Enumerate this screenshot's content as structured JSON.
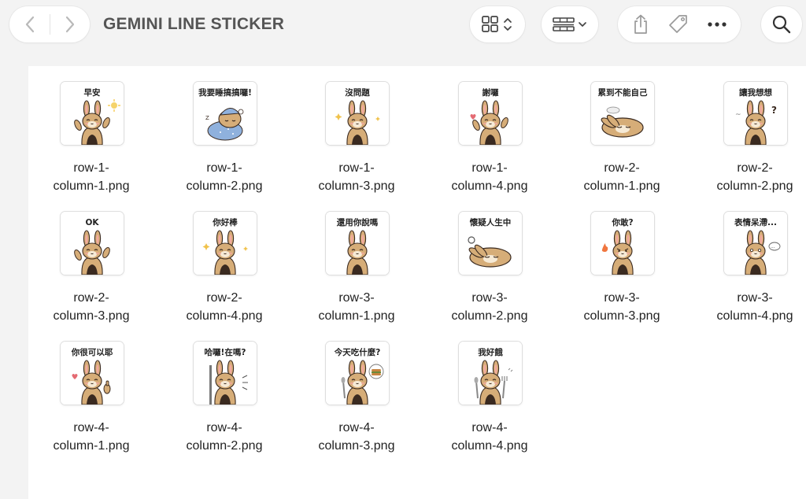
{
  "toolbar": {
    "title": "GEMINI LINE STICKER"
  },
  "files": [
    {
      "line1": "row-1-",
      "line2": "column-1.png",
      "caption": "早安",
      "pose": "wave",
      "prop": "sun"
    },
    {
      "line1": "row-1-",
      "line2": "column-2.png",
      "caption": "我要睡搞搞囉!",
      "pose": "sleep",
      "prop": "pillow"
    },
    {
      "line1": "row-1-",
      "line2": "column-3.png",
      "caption": "沒問題",
      "pose": "ok",
      "prop": "sparkle"
    },
    {
      "line1": "row-1-",
      "line2": "column-4.png",
      "caption": "謝囉",
      "pose": "thanks",
      "prop": "heart"
    },
    {
      "line1": "row-2-",
      "line2": "column-1.png",
      "caption": "累到不能自己",
      "pose": "lying",
      "prop": "cloud"
    },
    {
      "line1": "row-2-",
      "line2": "column-2.png",
      "caption": "讓我想想",
      "pose": "think",
      "prop": "question"
    },
    {
      "line1": "row-2-",
      "line2": "column-3.png",
      "caption": "OK",
      "pose": "wave",
      "prop": "none"
    },
    {
      "line1": "row-2-",
      "line2": "column-4.png",
      "caption": "你好棒",
      "pose": "clap",
      "prop": "sparkle"
    },
    {
      "line1": "row-3-",
      "line2": "column-1.png",
      "caption": "還用你說嗎",
      "pose": "arms",
      "prop": "none"
    },
    {
      "line1": "row-3-",
      "line2": "column-2.png",
      "caption": "懷疑人生中",
      "pose": "lying",
      "prop": "swirl"
    },
    {
      "line1": "row-3-",
      "line2": "column-3.png",
      "caption": "你敢?",
      "pose": "angry",
      "prop": "fire"
    },
    {
      "line1": "row-3-",
      "line2": "column-4.png",
      "caption": "表情呆滯...",
      "pose": "blank",
      "prop": "bubble"
    },
    {
      "line1": "row-4-",
      "line2": "column-1.png",
      "caption": "你很可以耶",
      "pose": "thumb",
      "prop": "heart"
    },
    {
      "line1": "row-4-",
      "line2": "column-2.png",
      "caption": "哈囉!在嗎?",
      "pose": "peek",
      "prop": "lines"
    },
    {
      "line1": "row-4-",
      "line2": "column-3.png",
      "caption": "今天吃什麼?",
      "pose": "spoon",
      "prop": "burger"
    },
    {
      "line1": "row-4-",
      "line2": "column-4.png",
      "caption": "我好餓",
      "pose": "hungry",
      "prop": "fork"
    }
  ]
}
